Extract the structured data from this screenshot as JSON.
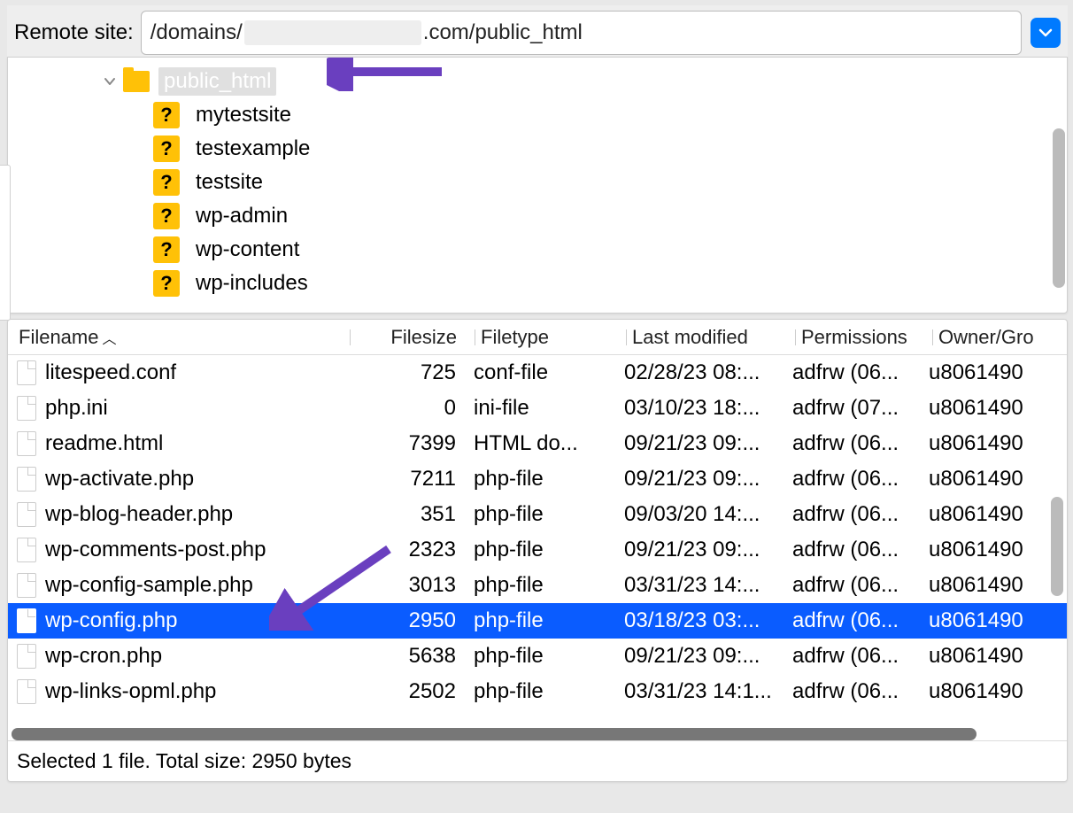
{
  "remote": {
    "label": "Remote site:",
    "path_prefix": "/domains/",
    "path_suffix": ".com/public_html"
  },
  "tree": {
    "root": {
      "name": "public_html",
      "selected": true
    },
    "children": [
      {
        "name": "mytestsite"
      },
      {
        "name": "testexample"
      },
      {
        "name": "testsite"
      },
      {
        "name": "wp-admin"
      },
      {
        "name": "wp-content"
      },
      {
        "name": "wp-includes"
      }
    ]
  },
  "columns": {
    "filename": "Filename",
    "filesize": "Filesize",
    "filetype": "Filetype",
    "last_modified": "Last modified",
    "permissions": "Permissions",
    "owner_group": "Owner/Gro"
  },
  "files": [
    {
      "name": "litespeed.conf",
      "size": "725",
      "type": "conf-file",
      "mod": "02/28/23 08:...",
      "perm": "adfrw (06...",
      "own": "u8061490"
    },
    {
      "name": "php.ini",
      "size": "0",
      "type": "ini-file",
      "mod": "03/10/23 18:...",
      "perm": "adfrw (07...",
      "own": "u8061490"
    },
    {
      "name": "readme.html",
      "size": "7399",
      "type": "HTML do...",
      "mod": "09/21/23 09:...",
      "perm": "adfrw (06...",
      "own": "u8061490"
    },
    {
      "name": "wp-activate.php",
      "size": "7211",
      "type": "php-file",
      "mod": "09/21/23 09:...",
      "perm": "adfrw (06...",
      "own": "u8061490"
    },
    {
      "name": "wp-blog-header.php",
      "size": "351",
      "type": "php-file",
      "mod": "09/03/20 14:...",
      "perm": "adfrw (06...",
      "own": "u8061490"
    },
    {
      "name": "wp-comments-post.php",
      "size": "2323",
      "type": "php-file",
      "mod": "09/21/23 09:...",
      "perm": "adfrw (06...",
      "own": "u8061490"
    },
    {
      "name": "wp-config-sample.php",
      "size": "3013",
      "type": "php-file",
      "mod": "03/31/23 14:...",
      "perm": "adfrw (06...",
      "own": "u8061490"
    },
    {
      "name": "wp-config.php",
      "size": "2950",
      "type": "php-file",
      "mod": "03/18/23 03:...",
      "perm": "adfrw (06...",
      "own": "u8061490",
      "selected": true
    },
    {
      "name": "wp-cron.php",
      "size": "5638",
      "type": "php-file",
      "mod": "09/21/23 09:...",
      "perm": "adfrw (06...",
      "own": "u8061490"
    },
    {
      "name": "wp-links-opml.php",
      "size": "2502",
      "type": "php-file",
      "mod": "03/31/23 14:1...",
      "perm": "adfrw (06...",
      "own": "u8061490"
    }
  ],
  "status": "Selected 1 file. Total size: 2950 bytes",
  "folder_q": "?"
}
